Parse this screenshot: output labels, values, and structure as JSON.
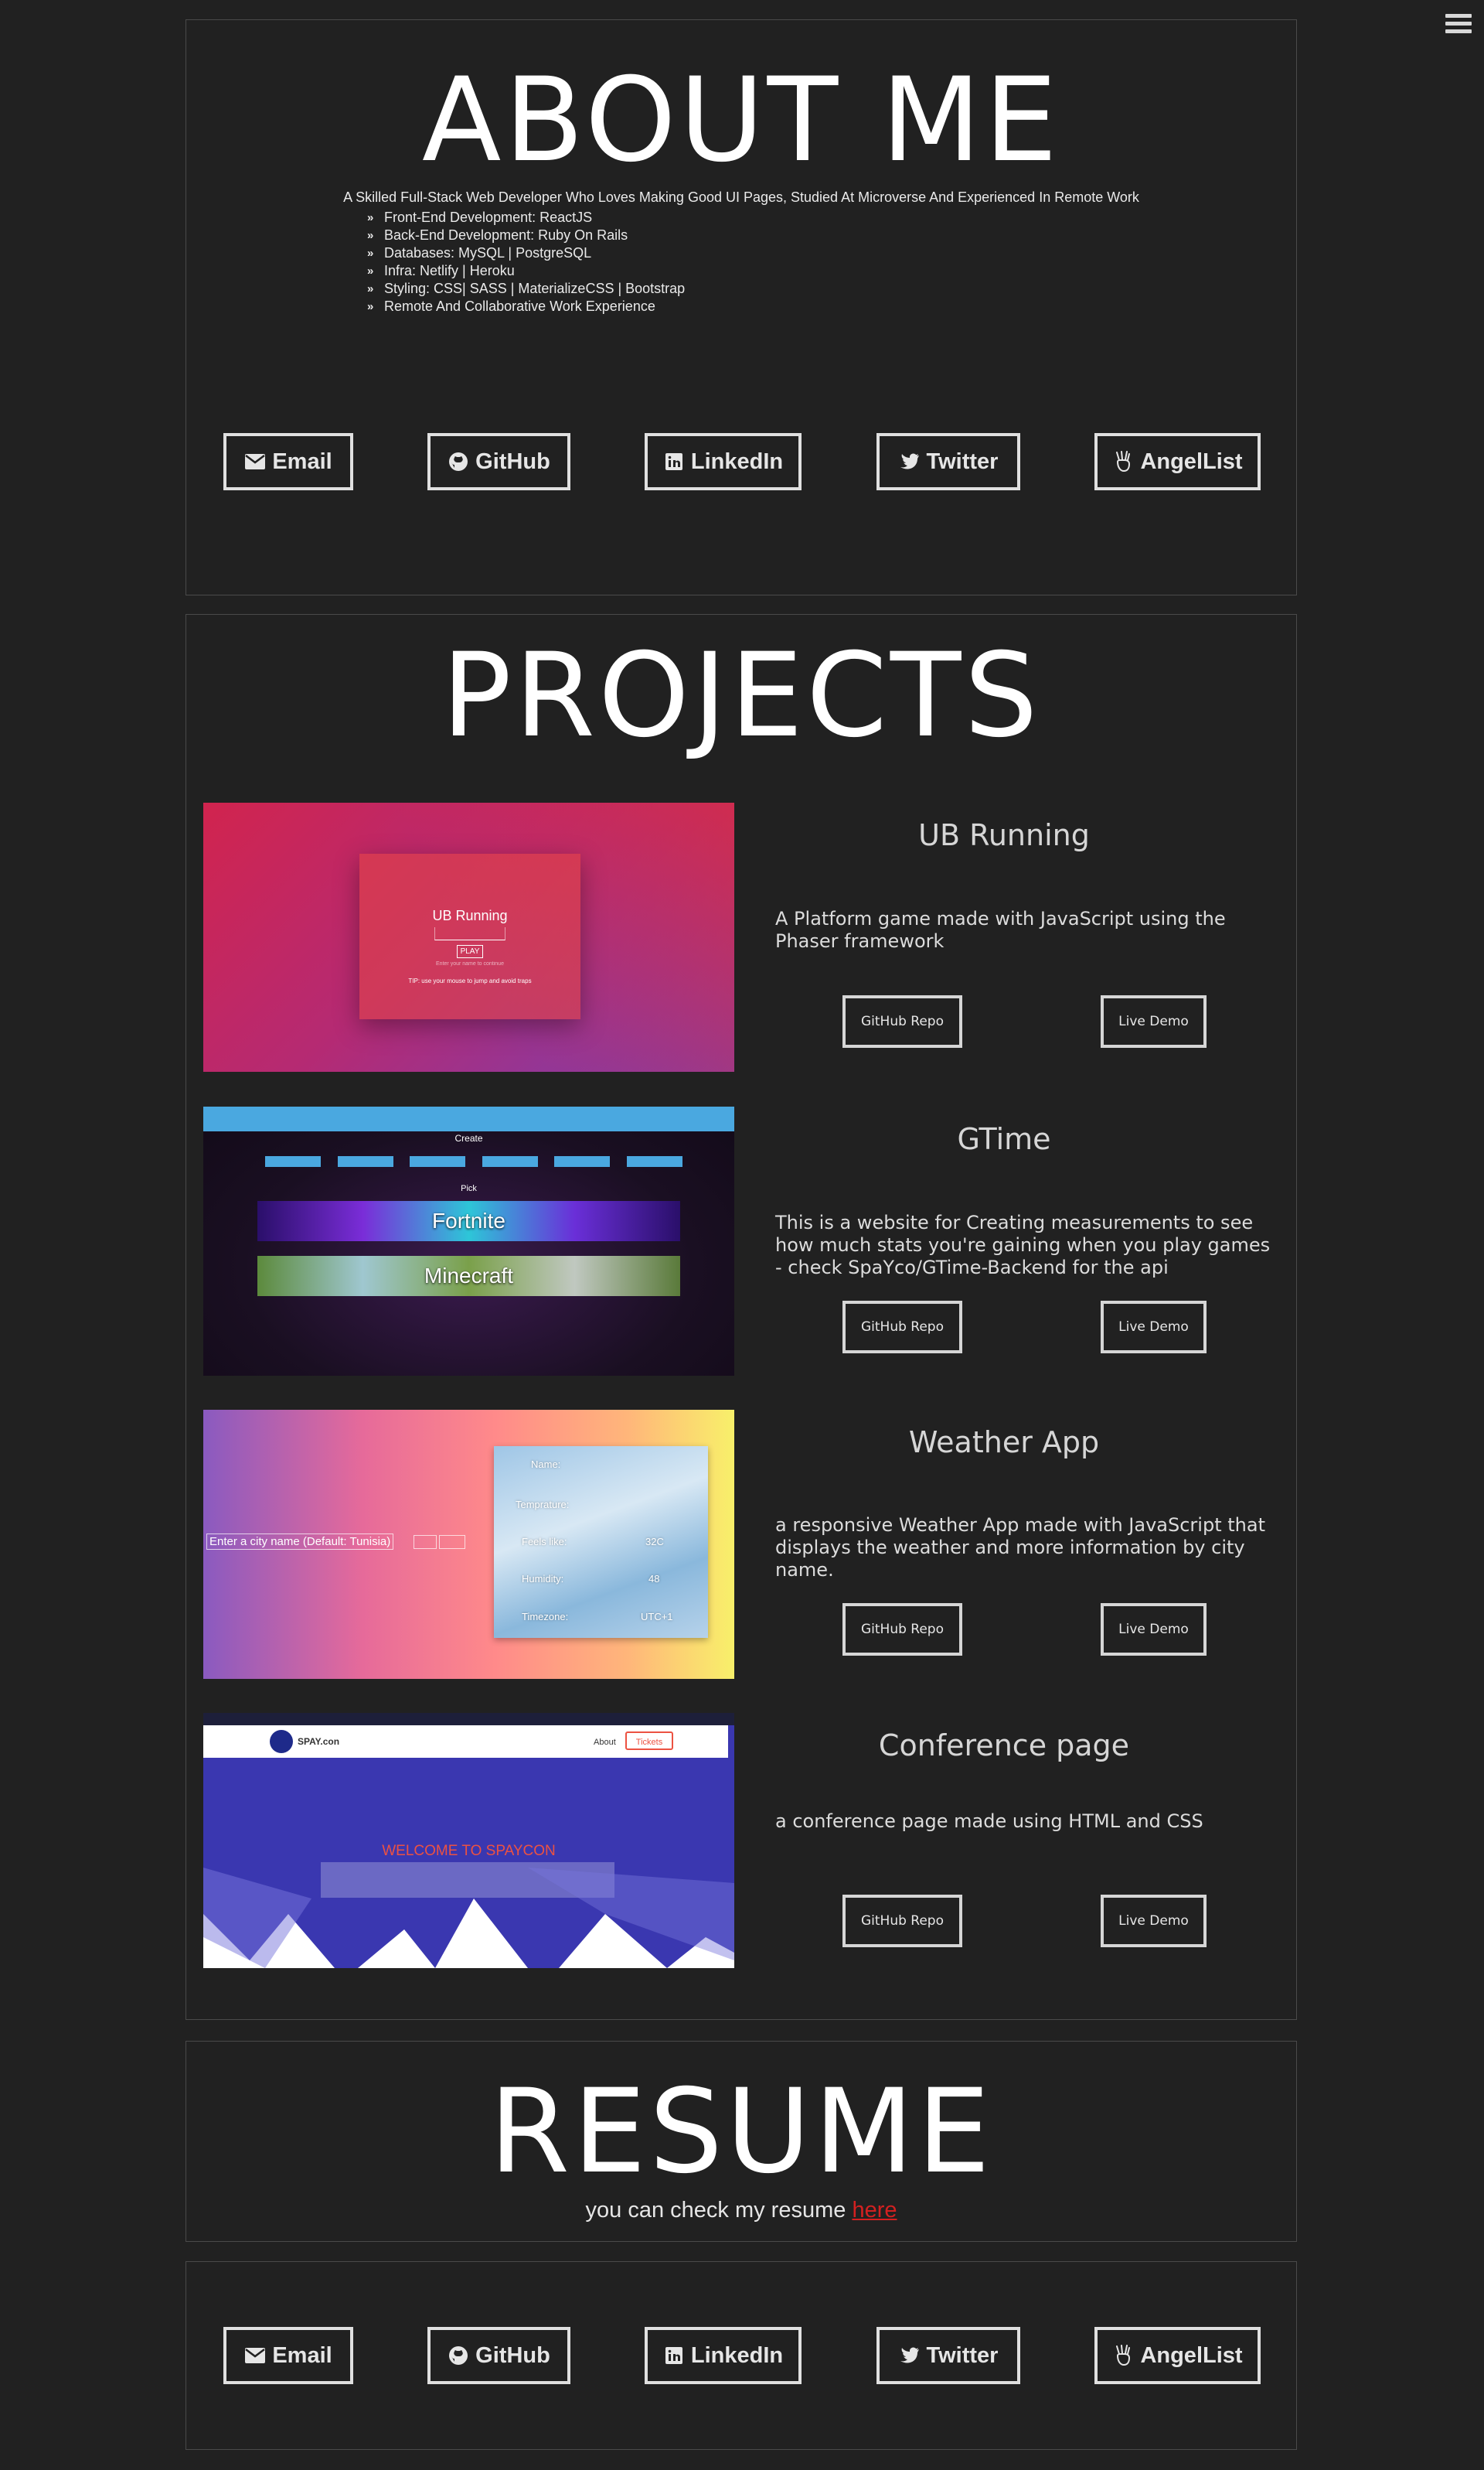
{
  "menu": {
    "icon": "hamburger-icon"
  },
  "about": {
    "title": "ABOUT ME",
    "intro": "A Skilled Full-Stack Web Developer Who Loves Making Good UI Pages, Studied At Microverse And Experienced In Remote Work",
    "skills": [
      "Front-End Development: ReactJS",
      "Back-End Development: Ruby On Rails",
      "Databases: MySQL | PostgreSQL",
      "Infra: Netlify | Heroku",
      "Styling: CSS| SASS | MaterializeCSS | Bootstrap",
      "Remote And Collaborative Work Experience"
    ]
  },
  "contacts": [
    {
      "label": "Email",
      "icon": "envelope-icon"
    },
    {
      "label": "GitHub",
      "icon": "github-icon"
    },
    {
      "label": "LinkedIn",
      "icon": "linkedin-icon"
    },
    {
      "label": "Twitter",
      "icon": "twitter-icon"
    },
    {
      "label": "AngelList",
      "icon": "angellist-icon"
    }
  ],
  "projects": {
    "title": "PROJECTS",
    "items": [
      {
        "name": "UB Running",
        "description": "A Platform game made with JavaScript using the Phaser framework",
        "repo_label": "GitHub Repo",
        "demo_label": "Live Demo",
        "screenshot": {
          "title": "UB Running",
          "play": "PLAY",
          "hint": "Enter your name to continue",
          "tip": "TIP: use your mouse to jump and avoid traps"
        }
      },
      {
        "name": "GTime",
        "description": "This is a website for Creating measurements to see how much stats you're gaining when you play games - check SpaYco/GTime-Backend for the api",
        "repo_label": "GitHub Repo",
        "demo_label": "Live Demo",
        "screenshot": {
          "create": "Create",
          "pick": "Pick",
          "game1": "Fortnite",
          "game2": "Minecraft"
        }
      },
      {
        "name": "Weather App",
        "description": "a responsive Weather App made with JavaScript that displays the weather and more information by city name.",
        "repo_label": "GitHub Repo",
        "demo_label": "Live Demo",
        "screenshot": {
          "city_input": "Enter a city name (Default: Tunisia)",
          "name": "Name:",
          "temp": "Temprature:",
          "feels": "Feels like:",
          "feels_val": "32C",
          "humidity": "Humidity:",
          "humidity_val": "48",
          "timezone": "Timezone:",
          "timezone_val": "UTC+1"
        }
      },
      {
        "name": "Conference page",
        "description": "a conference page made using HTML and CSS",
        "repo_label": "GitHub Repo",
        "demo_label": "Live Demo",
        "screenshot": {
          "brand": "SPAY.con",
          "nav_about": "About",
          "tickets": "Tickets",
          "welcome": "WELCOME TO SPAYCON"
        }
      }
    ]
  },
  "resume": {
    "title": "RESUME",
    "text": "you can check my resume ",
    "link_label": "here",
    "link_color": "#d42020"
  },
  "colors": {
    "background": "#212121",
    "border": "#4a4a4a",
    "text": "#ffffff"
  }
}
